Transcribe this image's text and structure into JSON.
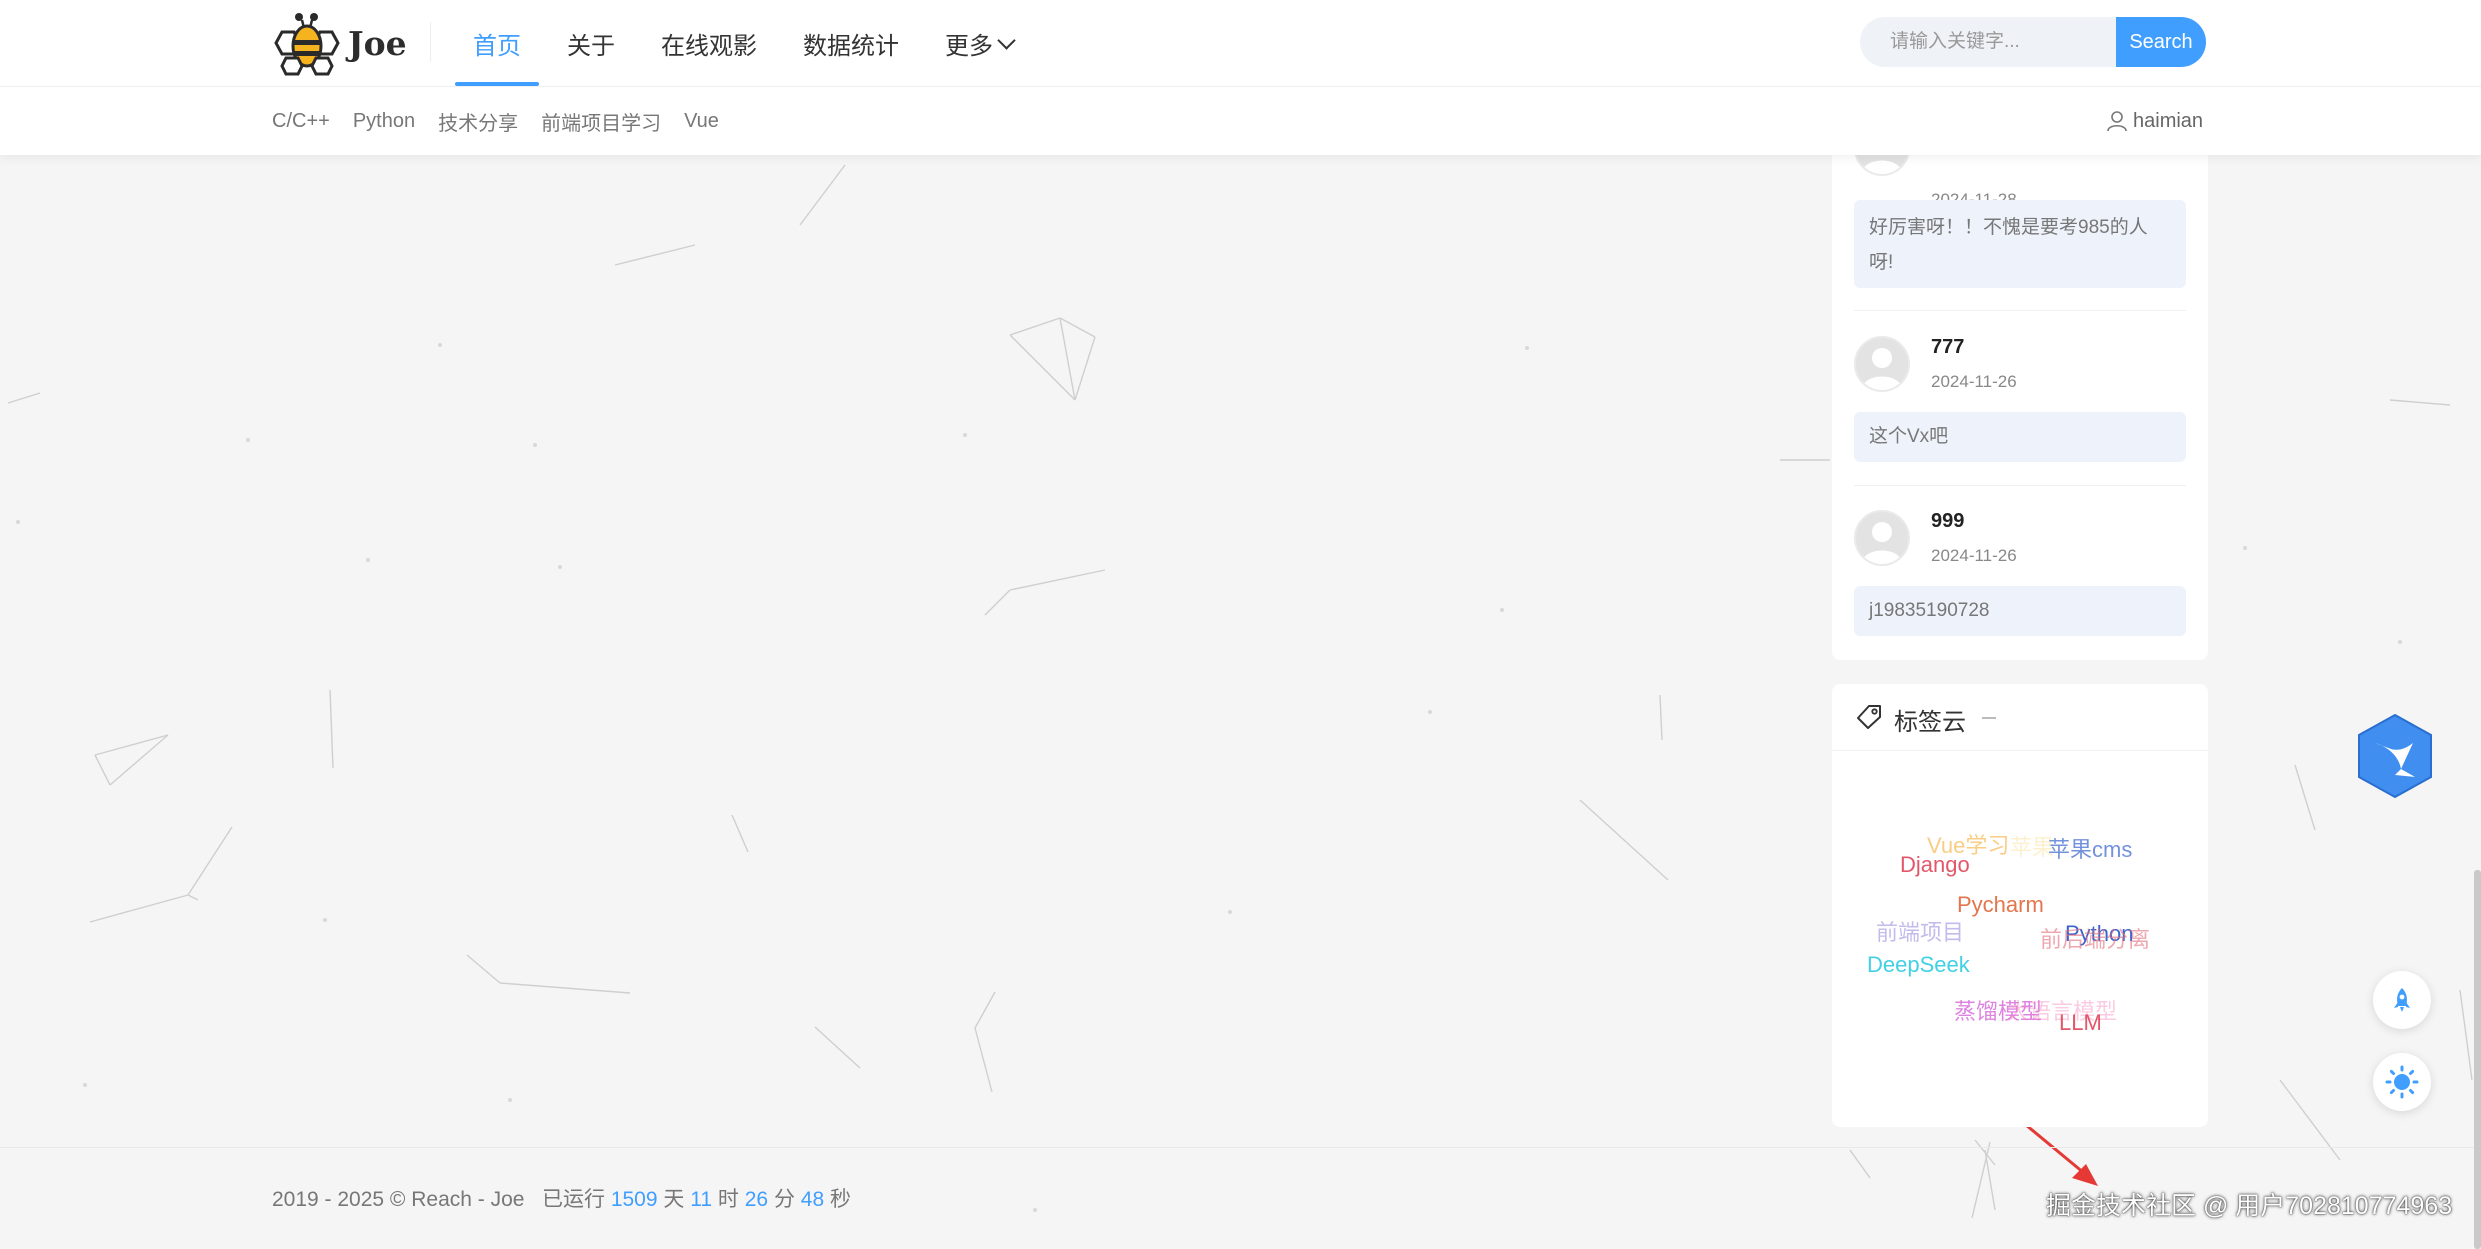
{
  "brand": {
    "name": "Joe"
  },
  "nav": {
    "items": [
      {
        "label": "首页",
        "active": true
      },
      {
        "label": "关于",
        "active": false
      },
      {
        "label": "在线观影",
        "active": false
      },
      {
        "label": "数据统计",
        "active": false
      },
      {
        "label": "更多",
        "active": false
      }
    ]
  },
  "search": {
    "placeholder": "请输入关键字...",
    "button_label": "Search"
  },
  "subnav": {
    "items": [
      "C/C++",
      "Python",
      "技术分享",
      "前端项目学习",
      "Vue"
    ]
  },
  "user": {
    "name": "haimian",
    "icon": "user-icon"
  },
  "comments": [
    {
      "name": "",
      "date": "2024-11-28",
      "text": "好厉害呀！！不愧是要考985的人呀!"
    },
    {
      "name": "777",
      "date": "2024-11-26",
      "text": "这个Vx吧"
    },
    {
      "name": "999",
      "date": "2024-11-26",
      "text": "j19835190728"
    }
  ],
  "tag_cloud": {
    "title": "标签云",
    "tags": [
      {
        "label": "Vue学习",
        "color": "#f5a623"
      },
      {
        "label": "苹果",
        "color": "#f7d774"
      },
      {
        "label": "苹果cms",
        "color": "#5b7fd6"
      },
      {
        "label": "Django",
        "color": "#e0455a"
      },
      {
        "label": "Pycharm",
        "color": "#e0683a"
      },
      {
        "label": "前端项目",
        "color": "#9b8fe0"
      },
      {
        "label": "Python",
        "color": "#2454c9"
      },
      {
        "label": "前后端分离",
        "color": "#e36d7a"
      },
      {
        "label": "DeepSeek",
        "color": "#21c8e0"
      },
      {
        "label": "蒸馏模型",
        "color": "#d25ad6"
      },
      {
        "label": "大语言模型",
        "color": "#f47fb8"
      },
      {
        "label": "LLM",
        "color": "#e0455a"
      }
    ]
  },
  "footer": {
    "copyright": "2019 - 2025 © Reach - Joe",
    "running_label": "已运行",
    "days": "1509",
    "days_unit": "天",
    "hours": "11",
    "hours_unit": "时",
    "minutes": "26",
    "minutes_unit": "分",
    "seconds": "48",
    "seconds_unit": "秒"
  },
  "watermark": "掘金技术社区 @ 用户702810774963",
  "colors": {
    "accent": "#409eff",
    "background": "#f5f5f5"
  },
  "icons": {
    "rocket": "rocket-icon",
    "theme": "sun-icon",
    "bird": "bird-icon",
    "tag": "tag-icon"
  }
}
